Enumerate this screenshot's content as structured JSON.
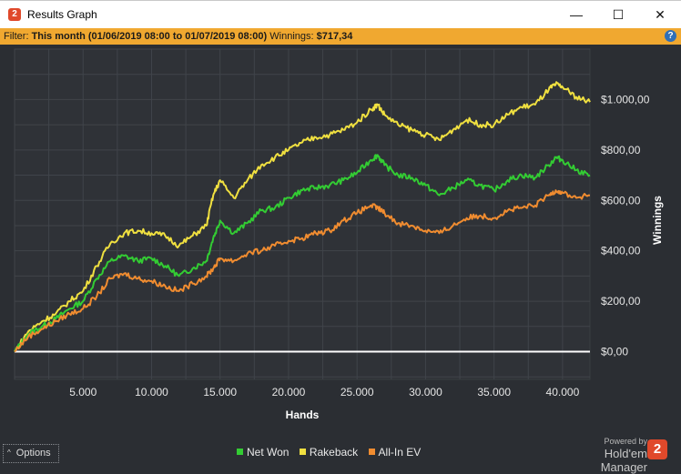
{
  "window": {
    "title": "Results Graph",
    "app_icon_glyph": "2",
    "minimize_glyph": "—",
    "maximize_glyph": "☐",
    "close_glyph": "✕"
  },
  "filter": {
    "prefix": "Filter:",
    "period": "This month (01/06/2019 08:00 to 01/07/2019 08:00)",
    "winnings_label": "Winnings:",
    "winnings_value": "$717,34",
    "help_glyph": "?"
  },
  "colors": {
    "net_won": "#33cc33",
    "rakeback": "#f0e040",
    "all_in_ev": "#f08c30",
    "zero_line": "#ffffff",
    "plot_bg": "#2f3237",
    "grid": "#40444a"
  },
  "chart_data": {
    "type": "line",
    "xlabel": "Hands",
    "ylabel": "Winnings",
    "xlim": [
      0,
      42000
    ],
    "ylim": [
      -110,
      1200
    ],
    "x_ticks": [
      5000,
      10000,
      15000,
      20000,
      25000,
      30000,
      35000,
      40000
    ],
    "x_tick_labels": [
      "5.000",
      "10.000",
      "15.000",
      "20.000",
      "25.000",
      "30.000",
      "35.000",
      "40.000"
    ],
    "y_ticks": [
      0,
      200,
      400,
      600,
      800,
      1000
    ],
    "y_tick_labels": [
      "$0,00",
      "$200,00",
      "$400,00",
      "$600,00",
      "$800,00",
      "$1.000,00"
    ],
    "grid": true,
    "x": [
      0,
      1000,
      2000,
      3000,
      4000,
      5000,
      6000,
      7000,
      8000,
      9000,
      10000,
      11000,
      12000,
      13000,
      14000,
      14500,
      15000,
      16000,
      17000,
      18000,
      19000,
      20000,
      21000,
      22000,
      23000,
      24000,
      25000,
      26000,
      26500,
      27000,
      28000,
      29000,
      30000,
      31000,
      32000,
      33000,
      34000,
      35000,
      36000,
      37000,
      38000,
      39000,
      39500,
      40000,
      41000,
      42000
    ],
    "series": [
      {
        "name": "Net Won",
        "values": [
          0,
          70,
          100,
          130,
          170,
          200,
          290,
          360,
          380,
          360,
          370,
          340,
          300,
          330,
          360,
          450,
          520,
          470,
          510,
          560,
          570,
          610,
          640,
          650,
          660,
          680,
          710,
          760,
          780,
          740,
          700,
          690,
          660,
          620,
          650,
          680,
          660,
          640,
          680,
          700,
          690,
          740,
          770,
          760,
          720,
          700
        ]
      },
      {
        "name": "Rakeback",
        "values": [
          0,
          80,
          120,
          150,
          200,
          240,
          340,
          430,
          470,
          480,
          470,
          460,
          420,
          460,
          500,
          620,
          680,
          610,
          680,
          740,
          770,
          800,
          830,
          850,
          860,
          880,
          910,
          960,
          980,
          940,
          900,
          880,
          860,
          840,
          880,
          920,
          900,
          900,
          940,
          970,
          980,
          1040,
          1060,
          1050,
          1010,
          990
        ]
      },
      {
        "name": "All-In EV",
        "values": [
          0,
          60,
          90,
          120,
          150,
          170,
          220,
          290,
          310,
          290,
          280,
          260,
          240,
          270,
          300,
          330,
          370,
          360,
          390,
          400,
          420,
          440,
          450,
          470,
          480,
          520,
          550,
          580,
          570,
          550,
          510,
          500,
          480,
          470,
          500,
          530,
          540,
          530,
          560,
          570,
          580,
          620,
          640,
          630,
          610,
          620
        ]
      }
    ]
  },
  "bottom": {
    "options_label": "Options",
    "options_caret": "^",
    "powered_by": "Powered by",
    "brand": "Hold'em Manager",
    "brand_logo_glyph": "2"
  }
}
